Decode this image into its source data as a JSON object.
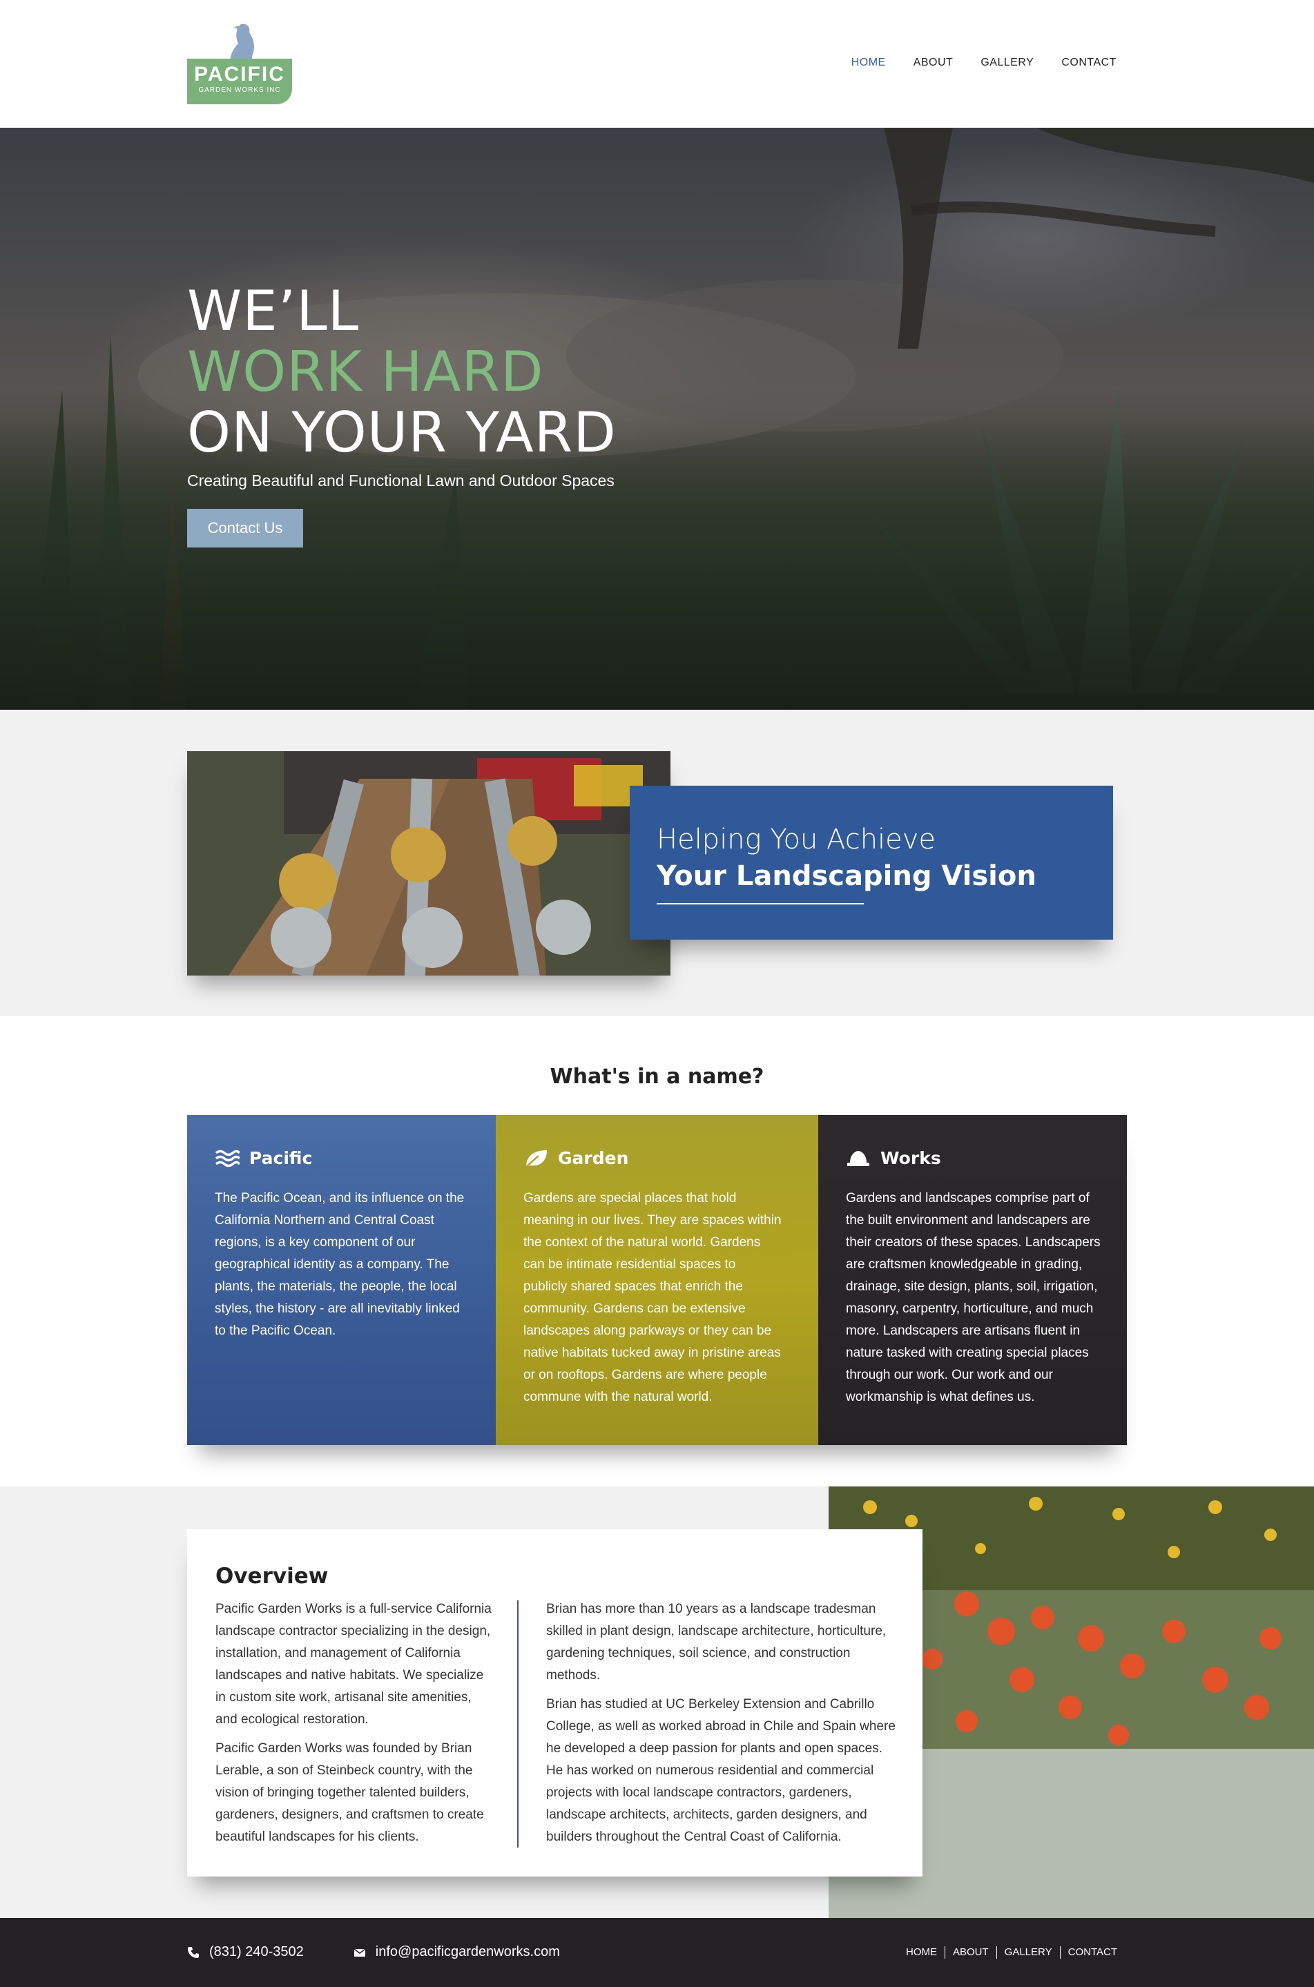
{
  "brand": {
    "logo_name": "PACIFIC",
    "logo_sub": "GARDEN WORKS INC",
    "primary_color": "#2f5998",
    "green_color": "#7fbb7f"
  },
  "nav": {
    "items": [
      {
        "label": "HOME",
        "active": true
      },
      {
        "label": "ABOUT",
        "active": false
      },
      {
        "label": "GALLERY",
        "active": false
      },
      {
        "label": "CONTACT",
        "active": false
      }
    ]
  },
  "hero": {
    "line1": "WE’LL",
    "line2": "WORK HARD",
    "line3": "ON YOUR YARD",
    "subtitle": "Creating Beautiful and Functional Lawn and Outdoor Spaces",
    "cta": "Contact Us"
  },
  "helping": {
    "line1": "Helping You Achieve",
    "line2": "Your Landscaping Vision"
  },
  "name_section": {
    "title": "What's in a name?",
    "columns": [
      {
        "icon": "waves-icon",
        "title": "Pacific",
        "body": "The Pacific Ocean, and its influence on the California Northern and Central Coast regions, is a key component of our geographical identity as a company. The plants, the materials, the people, the local styles, the history - are all inevitably linked to the Pacific Ocean."
      },
      {
        "icon": "leaf-icon",
        "title": "Garden",
        "body": "Gardens are special places that hold meaning in our lives. They are spaces within the context of the natural world. Gardens can be intimate residential spaces to publicly shared spaces that enrich the community. Gardens can be extensive landscapes along parkways or they can be native habitats tucked away in pristine areas or on rooftops. Gardens are where people commune with the natural world."
      },
      {
        "icon": "hard-hat-icon",
        "title": "Works",
        "body": "Gardens and landscapes comprise part of the built environment and landscapers are their creators of these spaces. Landscapers are craftsmen knowledgeable in grading, drainage, site design, plants, soil, irrigation, masonry, carpentry, horticulture, and much more. Landscapers are artisans fluent in nature tasked with creating special places through our work. Our work and our workmanship is what defines us."
      }
    ]
  },
  "overview": {
    "title": "Overview",
    "left": [
      "Pacific Garden Works is a full-service California landscape contractor specializing in the design, installation, and management of California landscapes and native habitats. We specialize in custom site work, artisanal site amenities, and ecological restoration.",
      "Pacific Garden Works was founded by Brian Lerable, a son of Steinbeck country, with the vision of bringing together talented builders, gardeners, designers, and craftsmen to create beautiful landscapes for his clients."
    ],
    "right": [
      "Brian has more than 10 years as a landscape tradesman skilled in plant design, landscape architecture, horticulture, gardening techniques, soil science, and construction methods.",
      "Brian has studied at UC Berkeley Extension and Cabrillo College, as well as worked abroad in Chile and Spain where he developed a deep passion for plants and open spaces. He has worked on numerous residential and commercial projects with local landscape contractors, gardeners, landscape architects, architects, garden designers, and builders throughout the Central Coast of California."
    ]
  },
  "footer": {
    "phone": "(831) 240-3502",
    "email": "info@pacificgardenworks.com",
    "nav": [
      "HOME",
      "ABOUT",
      "GALLERY",
      "CONTACT"
    ]
  }
}
